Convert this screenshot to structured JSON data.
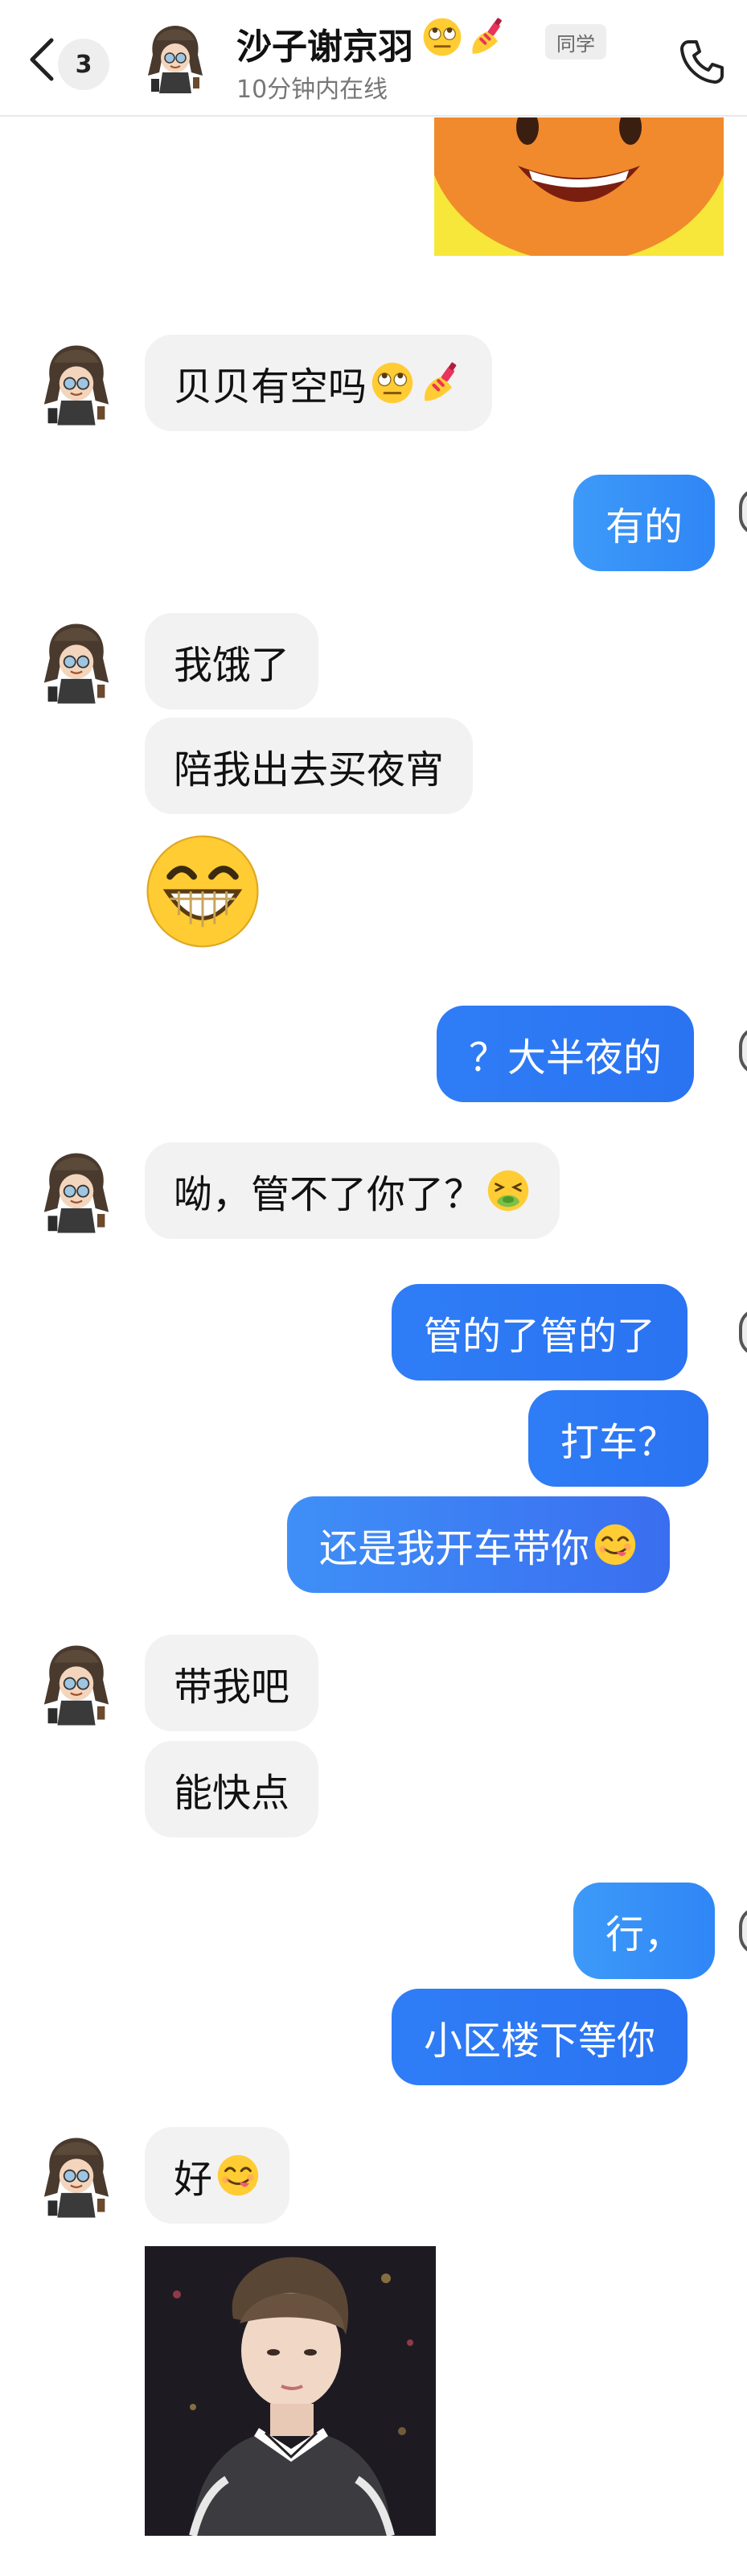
{
  "header": {
    "unread_count": "3",
    "contact_name": "沙子谢京羽",
    "name_emojis": [
      "eye-roll-emoji",
      "nail-polish-emoji"
    ],
    "relation_badge": "同学",
    "online_status": "10分钟内在线",
    "icons": {
      "back": "chevron-left-icon",
      "call": "phone-icon"
    }
  },
  "messages": [
    {
      "id": "m1",
      "from": "me",
      "type": "sticker",
      "content": "orange smiling face sticker (cropped)"
    },
    {
      "id": "m2",
      "from": "contact",
      "type": "text",
      "text": "贝贝有空吗",
      "emojis": [
        "eye-roll-emoji",
        "nail-polish-emoji"
      ]
    },
    {
      "id": "m3",
      "from": "me",
      "type": "text",
      "text": "有的"
    },
    {
      "id": "m4",
      "from": "contact",
      "type": "text",
      "text": "我饿了"
    },
    {
      "id": "m5",
      "from": "contact",
      "type": "text",
      "text": "陪我出去买夜宵"
    },
    {
      "id": "m6",
      "from": "contact",
      "type": "emoji",
      "emoji": "grinning-face-emoji"
    },
    {
      "id": "m7",
      "from": "me",
      "type": "text",
      "text": "？大半夜的"
    },
    {
      "id": "m8",
      "from": "contact",
      "type": "text",
      "text": "呦，管不了你了？",
      "emojis": [
        "nauseated-face-emoji"
      ]
    },
    {
      "id": "m9",
      "from": "me",
      "type": "text",
      "text": "管的了管的了"
    },
    {
      "id": "m10",
      "from": "me",
      "type": "text",
      "text": "打车？"
    },
    {
      "id": "m11",
      "from": "me",
      "type": "text",
      "text": "还是我开车带你",
      "emojis": [
        "yum-face-emoji"
      ]
    },
    {
      "id": "m12",
      "from": "contact",
      "type": "text",
      "text": "带我吧"
    },
    {
      "id": "m13",
      "from": "contact",
      "type": "text",
      "text": "能快点"
    },
    {
      "id": "m14",
      "from": "me",
      "type": "text",
      "text": "行，"
    },
    {
      "id": "m15",
      "from": "me",
      "type": "text",
      "text": "小区楼下等你"
    },
    {
      "id": "m16",
      "from": "contact",
      "type": "text",
      "text": "好",
      "emojis": [
        "yum-face-emoji"
      ]
    },
    {
      "id": "m17",
      "from": "contact",
      "type": "image",
      "content": "photo of a boy in a varsity jacket"
    }
  ],
  "colors": {
    "incoming_bubble": "#f2f2f2",
    "outgoing_bubble": "#2f7df6",
    "outgoing_text": "#ffffff",
    "background": "#ffffff"
  }
}
